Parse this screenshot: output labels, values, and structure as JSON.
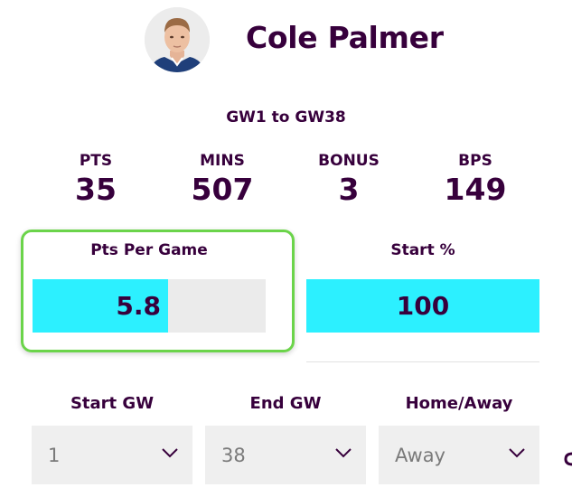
{
  "player": {
    "name": "Cole Palmer",
    "avatar_icon": "player-headshot-icon"
  },
  "range": "GW1 to GW38",
  "stats": [
    {
      "label": "PTS",
      "value": "35"
    },
    {
      "label": "MINS",
      "value": "507"
    },
    {
      "label": "BONUS",
      "value": "3"
    },
    {
      "label": "BPS",
      "value": "149"
    }
  ],
  "metrics": {
    "pts_per_game": {
      "label": "Pts Per Game",
      "value": "5.8",
      "fill_fraction": 0.58
    },
    "start_pct": {
      "label": "Start %",
      "value": "100",
      "fill_fraction": 1.0
    }
  },
  "filters": {
    "start_gw": {
      "label": "Start GW",
      "value": "1"
    },
    "end_gw": {
      "label": "End GW",
      "value": "38"
    },
    "home_away": {
      "label": "Home/Away",
      "value": "Away"
    }
  },
  "colors": {
    "text": "#37003c",
    "bar_fill": "#2cf0ff",
    "bar_track": "#ebebeb",
    "highlight_border": "#6bd44a",
    "select_bg": "#efefef"
  }
}
